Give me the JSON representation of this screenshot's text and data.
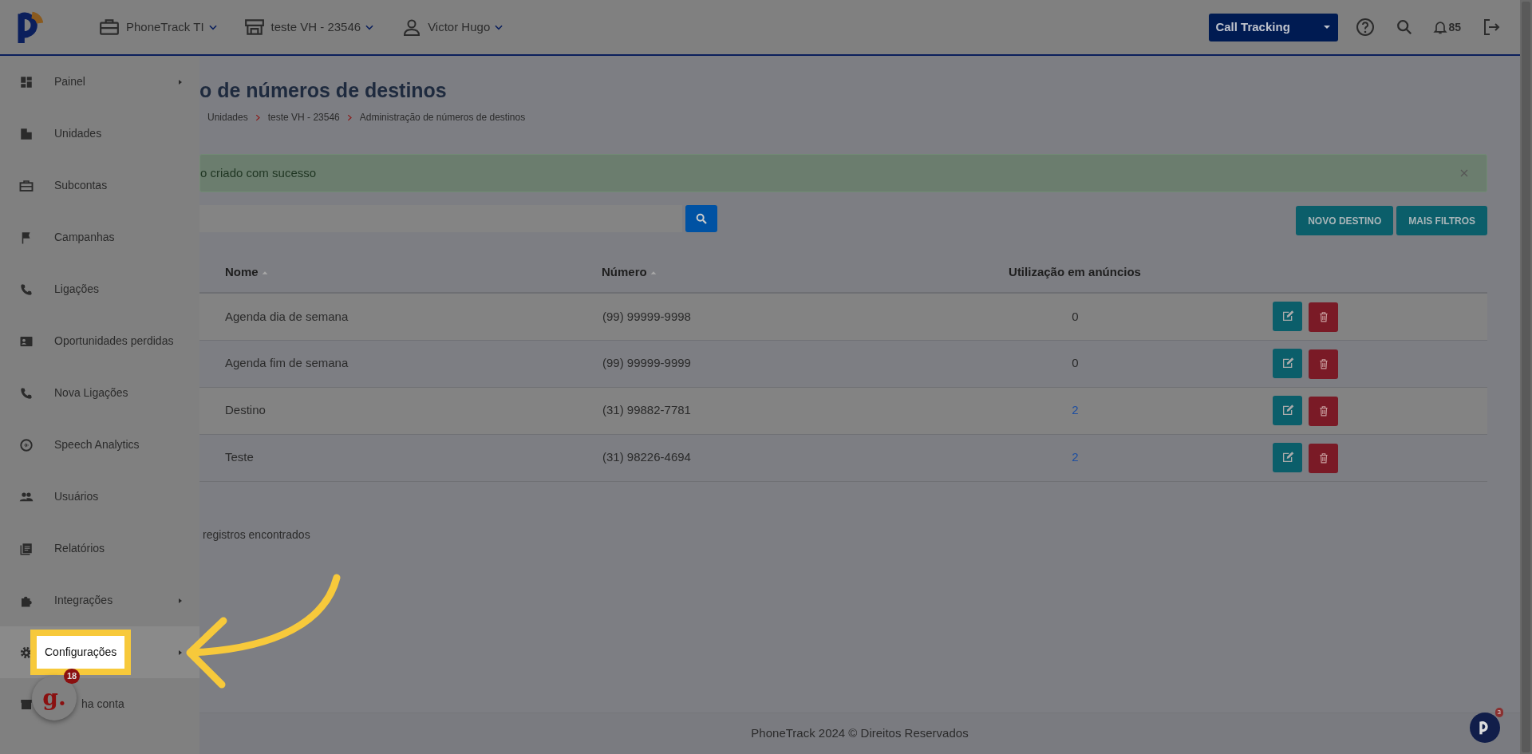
{
  "header": {
    "account": "PhoneTrack TI",
    "unit": "teste VH - 23546",
    "user": "Victor Hugo",
    "product_select": "Call Tracking",
    "notifications": "85"
  },
  "sidebar": {
    "items": [
      {
        "label": "Painel",
        "submenu": true,
        "highlighted": false
      },
      {
        "label": "Unidades",
        "submenu": false,
        "highlighted": false
      },
      {
        "label": "Subcontas",
        "submenu": false,
        "highlighted": false
      },
      {
        "label": "Campanhas",
        "submenu": false,
        "highlighted": false
      },
      {
        "label": "Ligações",
        "submenu": false,
        "highlighted": false
      },
      {
        "label": "Oportunidades perdidas",
        "submenu": false,
        "highlighted": false
      },
      {
        "label": "Nova Ligações",
        "submenu": false,
        "highlighted": false
      },
      {
        "label": "Speech Analytics",
        "submenu": false,
        "highlighted": false
      },
      {
        "label": "Usuários",
        "submenu": false,
        "highlighted": false
      },
      {
        "label": "Relatórios",
        "submenu": false,
        "highlighted": false
      },
      {
        "label": "Integrações",
        "submenu": true,
        "highlighted": false
      },
      {
        "label": "Configurações",
        "submenu": true,
        "highlighted": true
      },
      {
        "label": "ha conta",
        "submenu": false,
        "highlighted": false
      }
    ]
  },
  "page": {
    "title": "o de números de destinos",
    "breadcrumb": [
      "Unidades",
      "teste VH - 23546",
      "Administração de números de destinos"
    ]
  },
  "alert": {
    "text": "o criado com sucesso"
  },
  "toolbar": {
    "buttons": [
      "NOVO DESTINO",
      "MAIS FILTROS"
    ]
  },
  "table": {
    "columns": [
      {
        "label": "Nome",
        "sortable": true
      },
      {
        "label": "Número",
        "sortable": true
      },
      {
        "label": "Utilização em anúncios",
        "sortable": false
      }
    ],
    "rows": [
      {
        "name": "Agenda dia de semana",
        "number": "(99) 99999-9998",
        "usage": "0",
        "usage_link": false
      },
      {
        "name": "Agenda fim de semana",
        "number": "(99) 99999-9999",
        "usage": "0",
        "usage_link": false
      },
      {
        "name": "Destino",
        "number": "(31) 99882-7781",
        "usage": "2",
        "usage_link": true
      },
      {
        "name": "Teste",
        "number": "(31) 98226-4694",
        "usage": "2",
        "usage_link": true
      }
    ]
  },
  "records_text": "registros encontrados",
  "footer": "PhoneTrack 2024 © Direitos Reservados",
  "chat_widget": {
    "logo": "g.",
    "badge": "18"
  },
  "support_widget": {
    "badge": "3"
  }
}
